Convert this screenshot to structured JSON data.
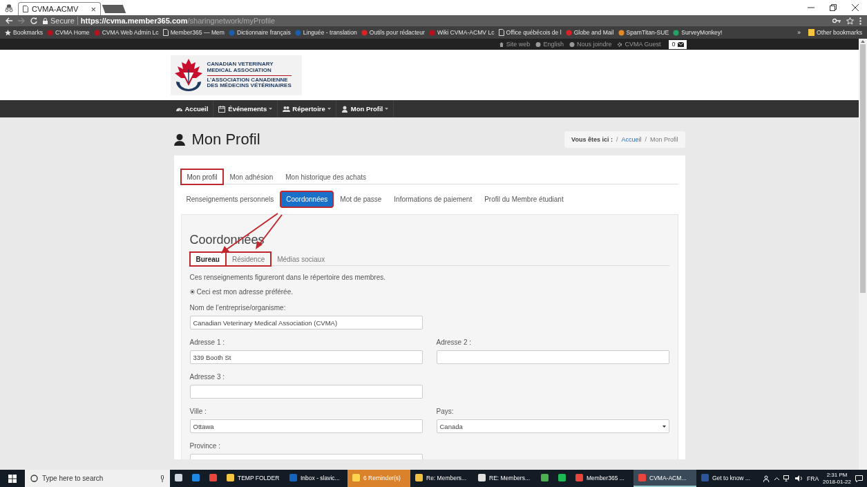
{
  "browser": {
    "tab": {
      "title": "CVMA-ACMV",
      "close": "×"
    },
    "secure_label": "Secure",
    "url_host": "https://cvma.member365.com",
    "url_path": "/sharingnetwork/myProfile",
    "bookmarks": [
      {
        "label": "Bookmarks",
        "kind": "star"
      },
      {
        "label": "CVMA Home",
        "kind": "favicon",
        "color": "#b5121b"
      },
      {
        "label": "CVMA Web Admin Lc",
        "kind": "favicon",
        "color": "#b5121b"
      },
      {
        "label": "Member365 — Mem",
        "kind": "page"
      },
      {
        "label": "Dictionnaire français",
        "kind": "favicon",
        "color": "#1b5fa8"
      },
      {
        "label": "Linguée - translation",
        "kind": "favicon",
        "color": "#1b5fa8"
      },
      {
        "label": "Outils pour rédacteur",
        "kind": "favicon",
        "color": "#d8232a"
      },
      {
        "label": "Wiki CVMA-ACMV Lc",
        "kind": "favicon",
        "color": "#b5121b"
      },
      {
        "label": "Office québécois de l",
        "kind": "page"
      },
      {
        "label": "Globe and Mail",
        "kind": "favicon",
        "color": "#d8232a"
      },
      {
        "label": "SpamTitan-SUE",
        "kind": "favicon",
        "color": "#e08a2a"
      },
      {
        "label": "SurveyMonkey!",
        "kind": "favicon",
        "color": "#1fa463"
      }
    ],
    "overflow": "»",
    "other_bookmarks": "Other bookmarks"
  },
  "utility_links": [
    "Site web",
    "English",
    "Nous joindre",
    "CVMA Guest"
  ],
  "message_count": "0",
  "logo": {
    "en_line1": "CANADIAN VETERINARY",
    "en_line2": "MEDICAL ASSOCIATION",
    "fr_line1": "L’ASSOCIATION CANADIENNE",
    "fr_line2": "DES MÉDECINS VÉTÉRINAIRES"
  },
  "nav": [
    {
      "label": "Accueil",
      "dropdown": false
    },
    {
      "label": "Événements",
      "dropdown": true
    },
    {
      "label": "Répertoire",
      "dropdown": true
    },
    {
      "label": "Mon Profil",
      "dropdown": true
    }
  ],
  "page_title": "Mon Profil",
  "breadcrumb": {
    "prefix": "Vous êtes ici :",
    "separator": "/",
    "items": [
      "Accueil",
      "Mon Profil"
    ]
  },
  "profile_tabs": [
    {
      "label": "Mon profil",
      "selected": true,
      "highlighted": true
    },
    {
      "label": "Mon adhésion",
      "selected": false,
      "highlighted": false
    },
    {
      "label": "Mon historique des achats",
      "selected": false,
      "highlighted": false
    }
  ],
  "section_tabs": [
    {
      "label": "Renseignements personnels",
      "selected": false,
      "highlighted": false
    },
    {
      "label": "Coordonnées",
      "selected": true,
      "highlighted": true
    },
    {
      "label": "Mot de passe",
      "selected": false,
      "highlighted": false
    },
    {
      "label": "Informations de paiement",
      "selected": false,
      "highlighted": false
    },
    {
      "label": "Profil du Membre étudiant",
      "selected": false,
      "highlighted": false
    }
  ],
  "panel": {
    "heading": "Coordonnées",
    "tabs": [
      {
        "label": "Bureau",
        "selected": true,
        "highlighted": true
      },
      {
        "label": "Résidence",
        "selected": false,
        "highlighted": true
      },
      {
        "label": "Médias sociaux",
        "selected": false,
        "highlighted": false
      }
    ],
    "note": "Ces renseignements figureront dans le répertoire des membres.",
    "preferred": {
      "label": "Ceci est mon adresse préférée.",
      "checked": true
    },
    "rows": [
      [
        {
          "label": "Nom de l’entreprise/organisme:",
          "kind": "text",
          "value": "Canadian Veterinary Medical Association (CVMA)"
        }
      ],
      [
        {
          "label": "Adresse 1 :",
          "kind": "text",
          "value": "339 Booth St"
        },
        {
          "label": "Adresse 2 :",
          "kind": "text"
        }
      ],
      [
        {
          "label": "Adresse 3 :",
          "kind": "text"
        }
      ],
      [
        {
          "label": "Ville :",
          "kind": "text",
          "value": "Ottawa"
        },
        {
          "label": "Pays:",
          "kind": "select",
          "value": "Canada"
        }
      ],
      [
        {
          "label": "Province :",
          "kind": "text"
        }
      ]
    ]
  },
  "taskbar": {
    "search_placeholder": "Type here to search",
    "items": [
      {
        "kind": "icon",
        "color": "#cfd8e0",
        "selected": false,
        "flashing": false
      },
      {
        "kind": "icon",
        "color": "#1e88e5",
        "selected": false,
        "flashing": false
      },
      {
        "kind": "icon",
        "color": "#e8453c",
        "selected": false,
        "flashing": false
      },
      {
        "kind": "labeled",
        "label": "TEMP FOLDER",
        "color": "#f5c542",
        "selected": false,
        "flashing": false
      },
      {
        "kind": "labeled",
        "label": "Inbox - slavic...",
        "color": "#1565c0",
        "selected": false,
        "flashing": false
      },
      {
        "kind": "labeled",
        "label": "6 Reminder(s)",
        "color": "#ffd54f",
        "selected": false,
        "flashing": true
      },
      {
        "kind": "labeled",
        "label": "Re: Members...",
        "color": "#f0c040",
        "selected": false,
        "flashing": false
      },
      {
        "kind": "labeled",
        "label": "RE: Members...",
        "color": "#e0e0e0",
        "selected": false,
        "flashing": false
      },
      {
        "kind": "icon",
        "color": "#4caf50",
        "selected": false,
        "flashing": false
      },
      {
        "kind": "icon",
        "color": "#1db954",
        "selected": false,
        "flashing": false
      },
      {
        "kind": "labeled",
        "label": "Member365 ...",
        "color": "#e8453c",
        "selected": false,
        "flashing": false
      },
      {
        "kind": "labeled",
        "label": "CVMA-ACM...",
        "color": "#e8453c",
        "selected": true,
        "flashing": false
      },
      {
        "kind": "labeled",
        "label": "Get to know ...",
        "color": "#2b579a",
        "selected": false,
        "flashing": false
      }
    ],
    "language": "FRA",
    "time": "2:31 PM",
    "date": "2018-01-22"
  }
}
